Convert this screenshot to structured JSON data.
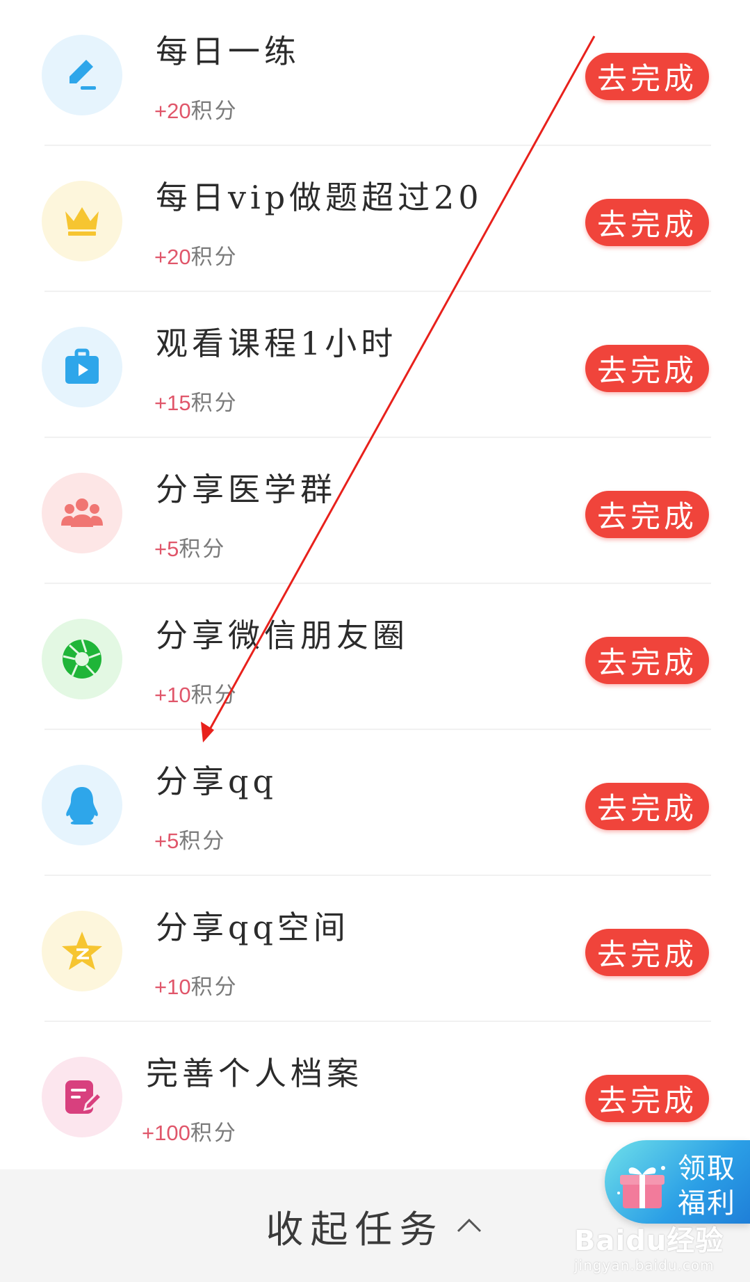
{
  "tasks": [
    {
      "title": "每日一练",
      "points_value": "+20",
      "points_unit": "积分",
      "button": "去完成",
      "icon": "pencil-icon",
      "icon_bg": "#e6f4fd",
      "icon_color": "#2ea6ea"
    },
    {
      "title": "每日vip做题超过20",
      "points_value": "+20",
      "points_unit": "积分",
      "button": "去完成",
      "icon": "crown-icon",
      "icon_bg": "#fdf6dc",
      "icon_color": "#f6c531"
    },
    {
      "title": "观看课程1小时",
      "points_value": "+15",
      "points_unit": "积分",
      "button": "去完成",
      "icon": "video-briefcase-icon",
      "icon_bg": "#e6f4fd",
      "icon_color": "#2ea6ea"
    },
    {
      "title": "分享医学群",
      "points_value": "+5",
      "points_unit": "积分",
      "button": "去完成",
      "icon": "group-icon",
      "icon_bg": "#fde6e6",
      "icon_color": "#f07673"
    },
    {
      "title": "分享微信朋友圈",
      "points_value": "+10",
      "points_unit": "积分",
      "button": "去完成",
      "icon": "moments-shutter-icon",
      "icon_bg": "#e3f8e3",
      "icon_color": "#1fb538"
    },
    {
      "title": "分享qq",
      "points_value": "+5",
      "points_unit": "积分",
      "button": "去完成",
      "icon": "qq-penguin-icon",
      "icon_bg": "#e6f4fd",
      "icon_color": "#2ea6ea"
    },
    {
      "title": "分享qq空间",
      "points_value": "+10",
      "points_unit": "积分",
      "button": "去完成",
      "icon": "qzone-star-icon",
      "icon_bg": "#fdf6dc",
      "icon_color": "#f6c531"
    },
    {
      "title": "完善个人档案",
      "points_value": "+100",
      "points_unit": "积分",
      "button": "去完成",
      "icon": "profile-edit-icon",
      "icon_bg": "#fce6ee",
      "icon_color": "#d8407e"
    }
  ],
  "collapse": {
    "label": "收起任务"
  },
  "welfare": {
    "line1": "领取",
    "line2": "福利"
  },
  "watermark": {
    "brand": "Baidu经验",
    "url": "jingyan.baidu.com"
  },
  "colors": {
    "button": "#f0443b",
    "points": "#e0566a",
    "arrow": "#e8211c"
  }
}
